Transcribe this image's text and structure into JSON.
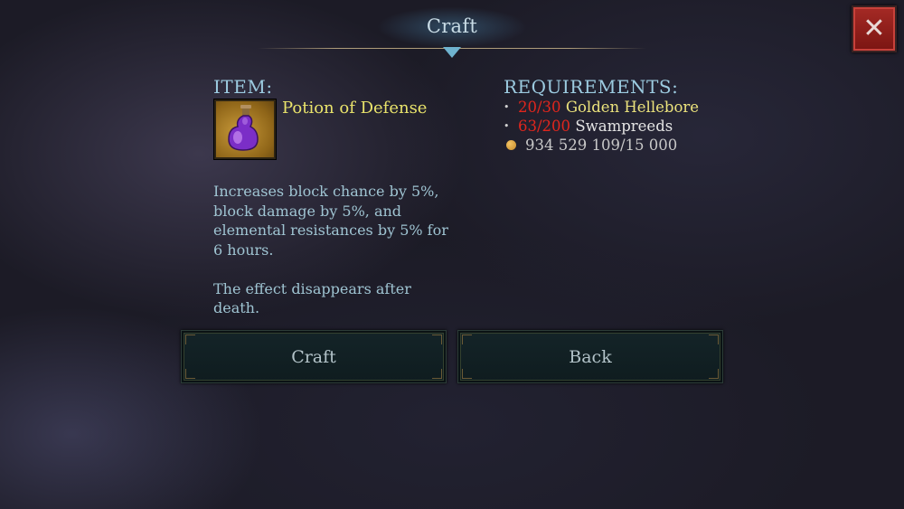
{
  "header": {
    "title": "Craft"
  },
  "close_button": {
    "icon": "close-icon",
    "glyph": "✕",
    "color": "#a52a25"
  },
  "item": {
    "label": "ITEM:",
    "name": "Potion of Defense",
    "icon": "purple-potion-icon",
    "description": [
      "Increases block chance by 5%, block damage by 5%, and elemental resistances by 5% for 6 hours.",
      "The effect disappears after death."
    ]
  },
  "requirements": {
    "label": "REQUIREMENTS:",
    "items": [
      {
        "have": "20/30",
        "name": "Golden Hellebore",
        "name_color": "#ece37c",
        "count_color": "#e0261d"
      },
      {
        "have": "63/200",
        "name": "Swampreeds",
        "name_color": "#e4e4e4",
        "count_color": "#e0261d"
      }
    ],
    "gold": {
      "icon": "gold-coin-icon",
      "text": "934 529 109/15 000"
    }
  },
  "buttons": {
    "craft": "Craft",
    "back": "Back"
  }
}
